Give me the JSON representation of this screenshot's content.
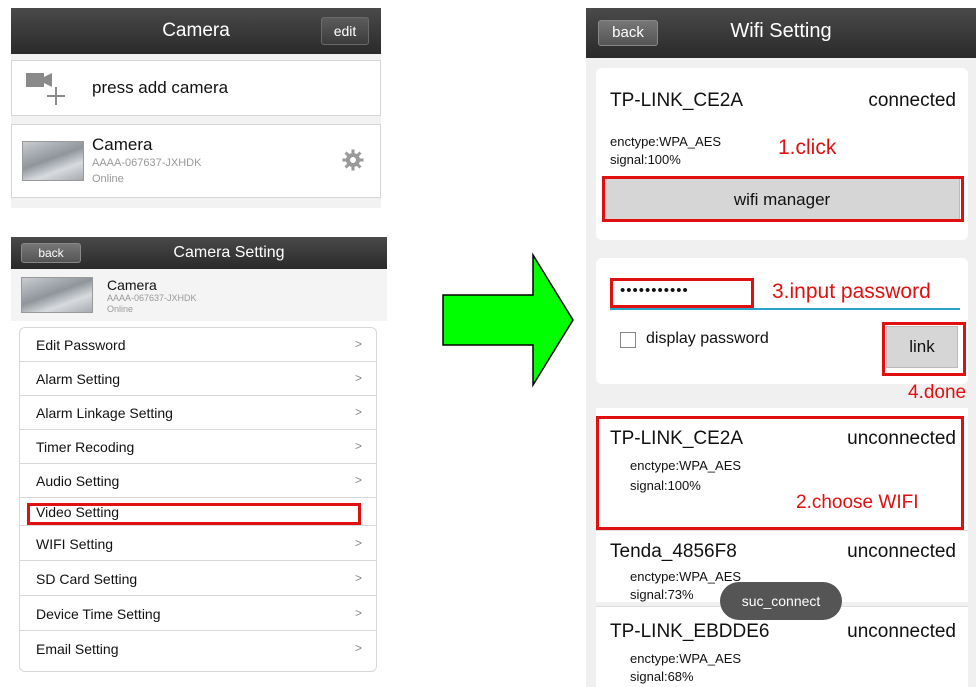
{
  "camera_list": {
    "title": "Camera",
    "edit_label": "edit",
    "add_label": "press add camera",
    "camera": {
      "name": "Camera",
      "uid": "AAAA-067637-JXHDK",
      "status": "Online"
    }
  },
  "camera_setting": {
    "back_label": "back",
    "title": "Camera Setting",
    "camera": {
      "name": "Camera",
      "uid": "AAAA-067637-JXHDK",
      "status": "Online"
    },
    "items": [
      {
        "label": "Edit Password"
      },
      {
        "label": "Alarm Setting"
      },
      {
        "label": "Alarm Linkage Setting"
      },
      {
        "label": "Timer Recoding"
      },
      {
        "label": "Audio Setting"
      },
      {
        "label": "Video Setting"
      },
      {
        "label": "WIFI Setting"
      },
      {
        "label": "SD Card Setting"
      },
      {
        "label": "Device Time Setting"
      },
      {
        "label": "Email Setting"
      }
    ],
    "chevron": ">"
  },
  "wifi_setting": {
    "back_label": "back",
    "title": "Wifi Setting",
    "current": {
      "ssid": "TP-LINK_CE2A",
      "state": "connected",
      "enctype": "enctype:WPA_AES",
      "signal": "signal:100%"
    },
    "manager_label": "wifi manager",
    "password_mask": "•••••••••••",
    "display_password_label": "display password",
    "link_label": "link",
    "networks": [
      {
        "ssid": "TP-LINK_CE2A",
        "state": "unconnected",
        "enctype": "enctype:WPA_AES",
        "signal": "signal:100%"
      },
      {
        "ssid": "Tenda_4856F8",
        "state": "unconnected",
        "enctype": "enctype:WPA_AES",
        "signal": "signal:73%"
      },
      {
        "ssid": "TP-LINK_EBDDE6",
        "state": "unconnected",
        "enctype": "enctype:WPA_AES",
        "signal": "signal:68%"
      }
    ],
    "toast": "suc_connect"
  },
  "annotations": {
    "step1": "1.click",
    "step2": "2.choose WIFI",
    "step3": "3.input password",
    "step4": "4.done"
  },
  "colors": {
    "arrow_fill": "#00ff00",
    "annotation_red": "#e01010"
  },
  "icons": {
    "add_camera": "video-camera-plus-icon",
    "settings": "gear-icon",
    "arrow": "right-arrow-icon"
  }
}
